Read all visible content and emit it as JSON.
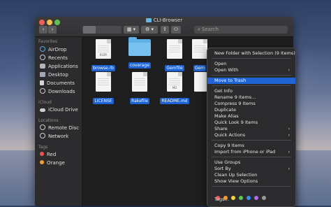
{
  "window": {
    "title": "CLI-Browser",
    "search_placeholder": "Search"
  },
  "toolbar": {
    "back_glyph": "‹",
    "forward_glyph": "›",
    "gear_glyph": "⚙",
    "share_glyph": "⇧",
    "search_glyph": "⌕"
  },
  "sidebar": {
    "favorites_header": "Favorites",
    "favorites": [
      {
        "label": "AirDrop",
        "icon": "airdrop-icon"
      },
      {
        "label": "Recents",
        "icon": "clock-icon"
      },
      {
        "label": "Applications",
        "icon": "applications-icon"
      },
      {
        "label": "Desktop",
        "icon": "desktop-icon"
      },
      {
        "label": "Documents",
        "icon": "document-icon"
      },
      {
        "label": "Downloads",
        "icon": "download-icon"
      }
    ],
    "icloud_header": "iCloud",
    "icloud_items": [
      {
        "label": "iCloud Drive",
        "icon": "cloud-icon"
      }
    ],
    "locations_header": "Locations",
    "locations": [
      {
        "label": "Remote Disc",
        "icon": "disc-icon"
      },
      {
        "label": "Network",
        "icon": "globe-icon"
      }
    ],
    "tags_header": "Tags",
    "tags": [
      {
        "label": "Red",
        "color": "#f0534d"
      },
      {
        "label": "Orange",
        "color": "#f79a2f"
      }
    ]
  },
  "files": [
    {
      "name": "browse.rb",
      "type": "doc",
      "ext": "RUBY"
    },
    {
      "name": "coverage",
      "type": "folder"
    },
    {
      "name": "Gemfile",
      "type": "doc"
    },
    {
      "name": "Gem",
      "type": "doc"
    },
    {
      "name": "LICENSE",
      "type": "doc"
    },
    {
      "name": "Rakefile",
      "type": "doc"
    },
    {
      "name": "README.md",
      "type": "doc",
      "ext": "MD"
    }
  ],
  "context_menu": {
    "items": [
      {
        "label": "New Folder with Selection (9 Items)"
      },
      {
        "label": "Open"
      },
      {
        "label": "Open With",
        "submenu": true
      },
      {
        "label": "Move to Trash",
        "highlighted": true
      },
      {
        "label": "Get Info"
      },
      {
        "label": "Rename 9 Items…"
      },
      {
        "label": "Compress 9 Items"
      },
      {
        "label": "Duplicate"
      },
      {
        "label": "Make Alias"
      },
      {
        "label": "Quick Look 9 Items"
      },
      {
        "label": "Share",
        "submenu": true
      },
      {
        "label": "Quick Actions",
        "submenu": true
      },
      {
        "label": "Copy 9 Items"
      },
      {
        "label": "Import from iPhone or iPad",
        "submenu": true
      },
      {
        "label": "Use Groups"
      },
      {
        "label": "Sort By",
        "submenu": true
      },
      {
        "label": "Clean Up Selection"
      },
      {
        "label": "Show View Options"
      },
      {
        "label": "Tags…"
      }
    ],
    "submenu_glyph": "›",
    "tag_colors": [
      "#f0534d",
      "#f79a2f",
      "#f5d13c",
      "#5fc454",
      "#3b8ff3",
      "#b36ae2",
      "#9a9a9a"
    ]
  }
}
